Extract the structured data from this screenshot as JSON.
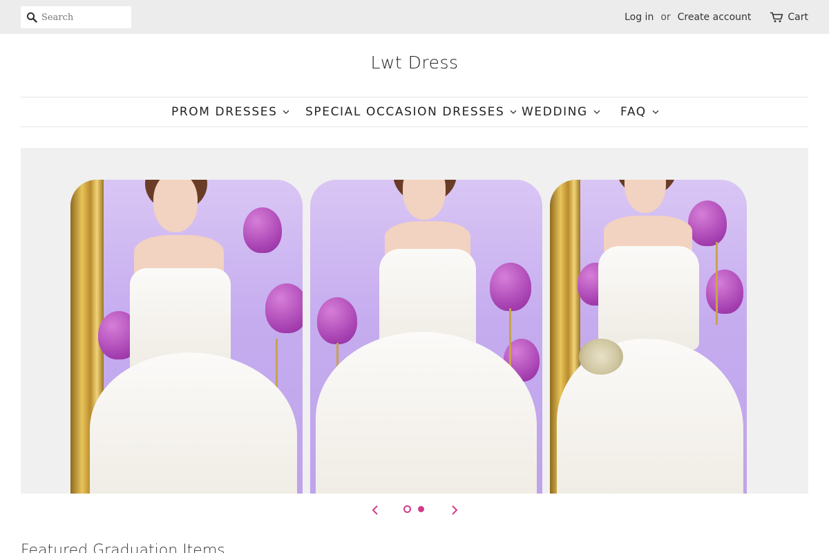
{
  "header": {
    "search": {
      "placeholder": "Search"
    },
    "account": {
      "login_label": "Log in",
      "or_label": "or",
      "create_label": "Create account",
      "cart_label": "Cart"
    }
  },
  "logo": {
    "title": "Lwt Dress"
  },
  "nav": {
    "items": [
      {
        "label": "PROM DRESSES"
      },
      {
        "label": "SPECIAL OCCASION DRESSES"
      },
      {
        "label": "WEDDING"
      },
      {
        "label": "FAQ"
      }
    ]
  },
  "slideshow": {
    "slide_count": 2,
    "active_slide": 1,
    "accent_color": "#d23a8a"
  },
  "featured": {
    "title": "Featured Graduation Items"
  },
  "icons": {
    "search": "search-icon",
    "cart": "cart-icon",
    "nav_dropdown": "chevron-down-icon",
    "prev": "chevron-left-icon",
    "next": "chevron-right-icon"
  }
}
